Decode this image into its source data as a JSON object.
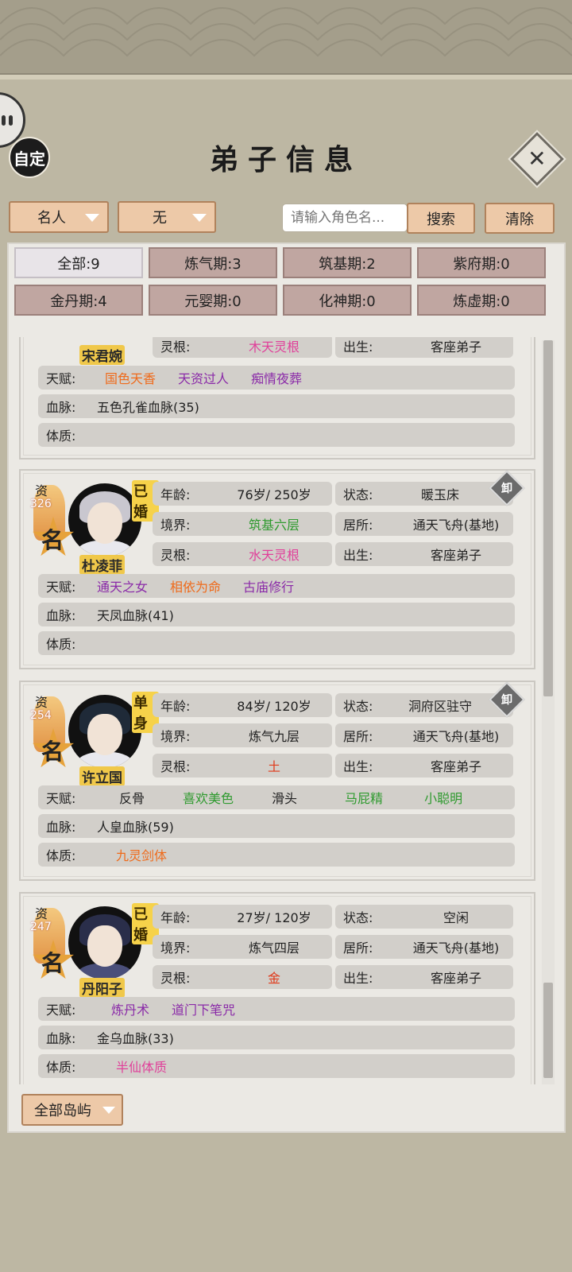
{
  "header": {
    "title": "弟子信息",
    "auto_label": "自定",
    "close_icon": "close-icon"
  },
  "filters": {
    "category": "名人",
    "secondary": "无",
    "search_placeholder": "请输入角色名...",
    "search_button": "搜索",
    "clear_button": "清除"
  },
  "realm_tabs": [
    {
      "label": "全部:9",
      "active": true
    },
    {
      "label": "炼气期:3"
    },
    {
      "label": "筑基期:2"
    },
    {
      "label": "紫府期:0"
    },
    {
      "label": "金丹期:4"
    },
    {
      "label": "元婴期:0"
    },
    {
      "label": "化神期:0"
    },
    {
      "label": "炼虚期:0"
    }
  ],
  "labels": {
    "age": "年龄:",
    "status": "状态:",
    "realm": "境界:",
    "residence": "居所:",
    "root": "灵根:",
    "birth": "出生:",
    "talent": "天赋:",
    "bloodline": "血脉:",
    "physique": "体质:",
    "zi": "资",
    "ming": "名",
    "unload": "卸"
  },
  "disciples": [
    {
      "name": "宋君婉",
      "root": "木天灵根",
      "birth": "客座弟子",
      "talents": [
        "国色天香",
        "天资过人",
        "痴情夜葬"
      ],
      "bloodline": "五色孔雀血脉(35)",
      "physique": ""
    },
    {
      "name": "杜凌菲",
      "status_badge": "已婚",
      "aptitude": "326",
      "age": "76岁/ 250岁",
      "state": "暖玉床",
      "realm": "筑基六层",
      "residence": "通天飞舟(基地)",
      "root": "水天灵根",
      "birth": "客座弟子",
      "talents": [
        "通天之女",
        "相依为命",
        "古庙修行"
      ],
      "bloodline": "天凤血脉(41)",
      "physique": ""
    },
    {
      "name": "许立国",
      "status_badge": "单身",
      "aptitude": "254",
      "age": "84岁/ 120岁",
      "state": "洞府区驻守",
      "realm": "炼气九层",
      "residence": "通天飞舟(基地)",
      "root": "土",
      "birth": "客座弟子",
      "talents": [
        "反骨",
        "喜欢美色",
        "滑头",
        "马屁精",
        "小聪明"
      ],
      "bloodline": "人皇血脉(59)",
      "physique": "九灵剑体"
    },
    {
      "name": "丹阳子",
      "status_badge": "已婚",
      "aptitude": "247",
      "age": "27岁/ 120岁",
      "state": "空闲",
      "realm": "炼气四层",
      "residence": "通天飞舟(基地)",
      "root": "金",
      "birth": "客座弟子",
      "talents": [
        "炼丹术",
        "道门下笔咒"
      ],
      "bloodline": "金乌血脉(33)",
      "physique": "半仙体质"
    }
  ],
  "footer": {
    "island_filter": "全部岛屿"
  },
  "colors": {
    "accent": "#edc9a8",
    "tab": "#c0a6a1",
    "panel": "#ebe9e4"
  }
}
